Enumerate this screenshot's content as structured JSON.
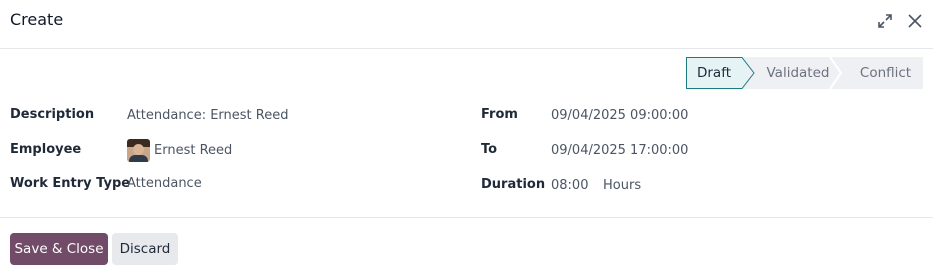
{
  "dialog": {
    "title": "Create",
    "icons": [
      "expand-icon",
      "close-icon"
    ]
  },
  "status": {
    "stages": [
      "Draft",
      "Validated",
      "Conflict"
    ],
    "active": "Draft",
    "colors": {
      "active_bg": "#e6f3f4",
      "active_border": "#1f7a80",
      "inactive_bg": "#eef0f3"
    }
  },
  "fields": {
    "description": {
      "label": "Description",
      "value": "Attendance: Ernest Reed"
    },
    "employee": {
      "label": "Employee",
      "value": "Ernest Reed"
    },
    "work_entry_type": {
      "label": "Work Entry Type",
      "value": "Attendance"
    },
    "from": {
      "label": "From",
      "value": "09/04/2025 09:00:00"
    },
    "to": {
      "label": "To",
      "value": "09/04/2025 17:00:00"
    },
    "duration": {
      "label": "Duration",
      "value": "08:00",
      "unit": "Hours"
    }
  },
  "footer": {
    "save_label": "Save & Close",
    "discard_label": "Discard",
    "primary_color": "#714b67"
  }
}
